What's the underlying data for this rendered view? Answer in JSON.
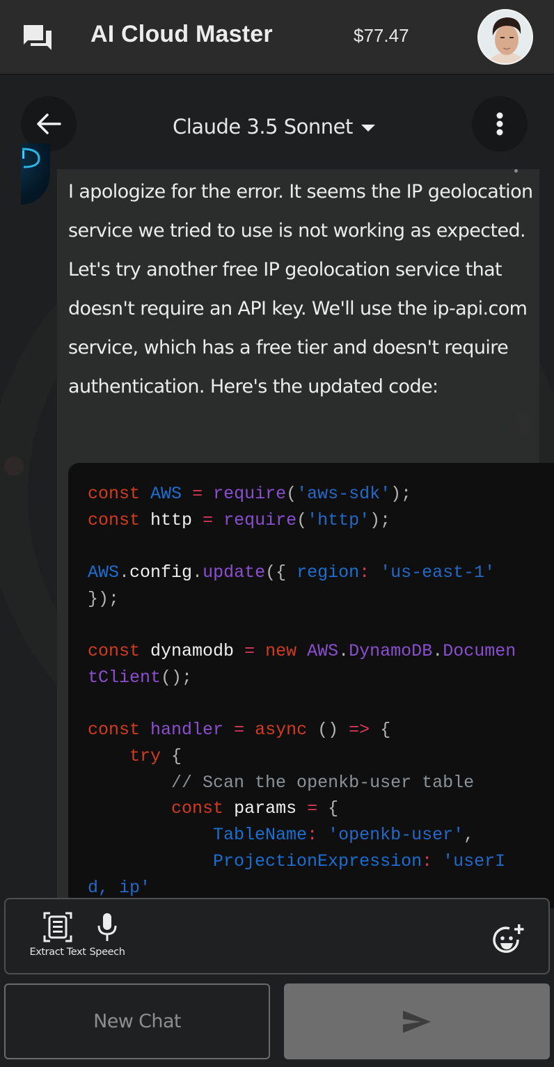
{
  "appbar": {
    "title": "AI Cloud Master",
    "balance": "$77.47",
    "icons": {
      "left": "chat-bubbles-icon",
      "right": "user-avatar"
    }
  },
  "header": {
    "model": "Claude 3.5 Sonnet",
    "back_icon": "arrow-left-icon",
    "menu_icon": "more-vertical-icon",
    "dropdown_icon": "caret-down-icon"
  },
  "message": {
    "role": "assistant",
    "text": "I apologize for the error. It seems the IP geolocation service we tried to use is not working as expected. Let's try another free IP geolocation service that doesn't require an API key. We'll use the ip-api.com service, which has a free tier and doesn't require authentication. Here's the updated code:",
    "code_lines": [
      "const AWS = require('aws-sdk');",
      "const http = require('http');",
      "",
      "AWS.config.update({ region: 'us-east-1' });",
      "",
      "const dynamodb = new AWS.DynamoDB.DocumentClient();",
      "",
      "const handler = async () => {",
      "    try {",
      "        // Scan the openkb-user table",
      "        const params = {",
      "            TableName: 'openkb-user',",
      "            ProjectionExpression: 'userId, ip'"
    ]
  },
  "toolbar": {
    "extract_text_label": "Extract Text",
    "speech_label": "Speech",
    "extract_icon": "document-scan-icon",
    "speech_icon": "microphone-icon",
    "emoji_icon": "add-emoji-icon"
  },
  "actions": {
    "new_chat_label": "New Chat",
    "send_icon": "send-icon"
  },
  "colors": {
    "appbar_bg": "#2b2b2b",
    "page_bg": "#1e1f20",
    "code_bg": "#0f0f0f",
    "keyword": "#d13c20",
    "function": "#8a4fcf",
    "string": "#2469c8",
    "send_button_bg": "#6e6e6e"
  }
}
